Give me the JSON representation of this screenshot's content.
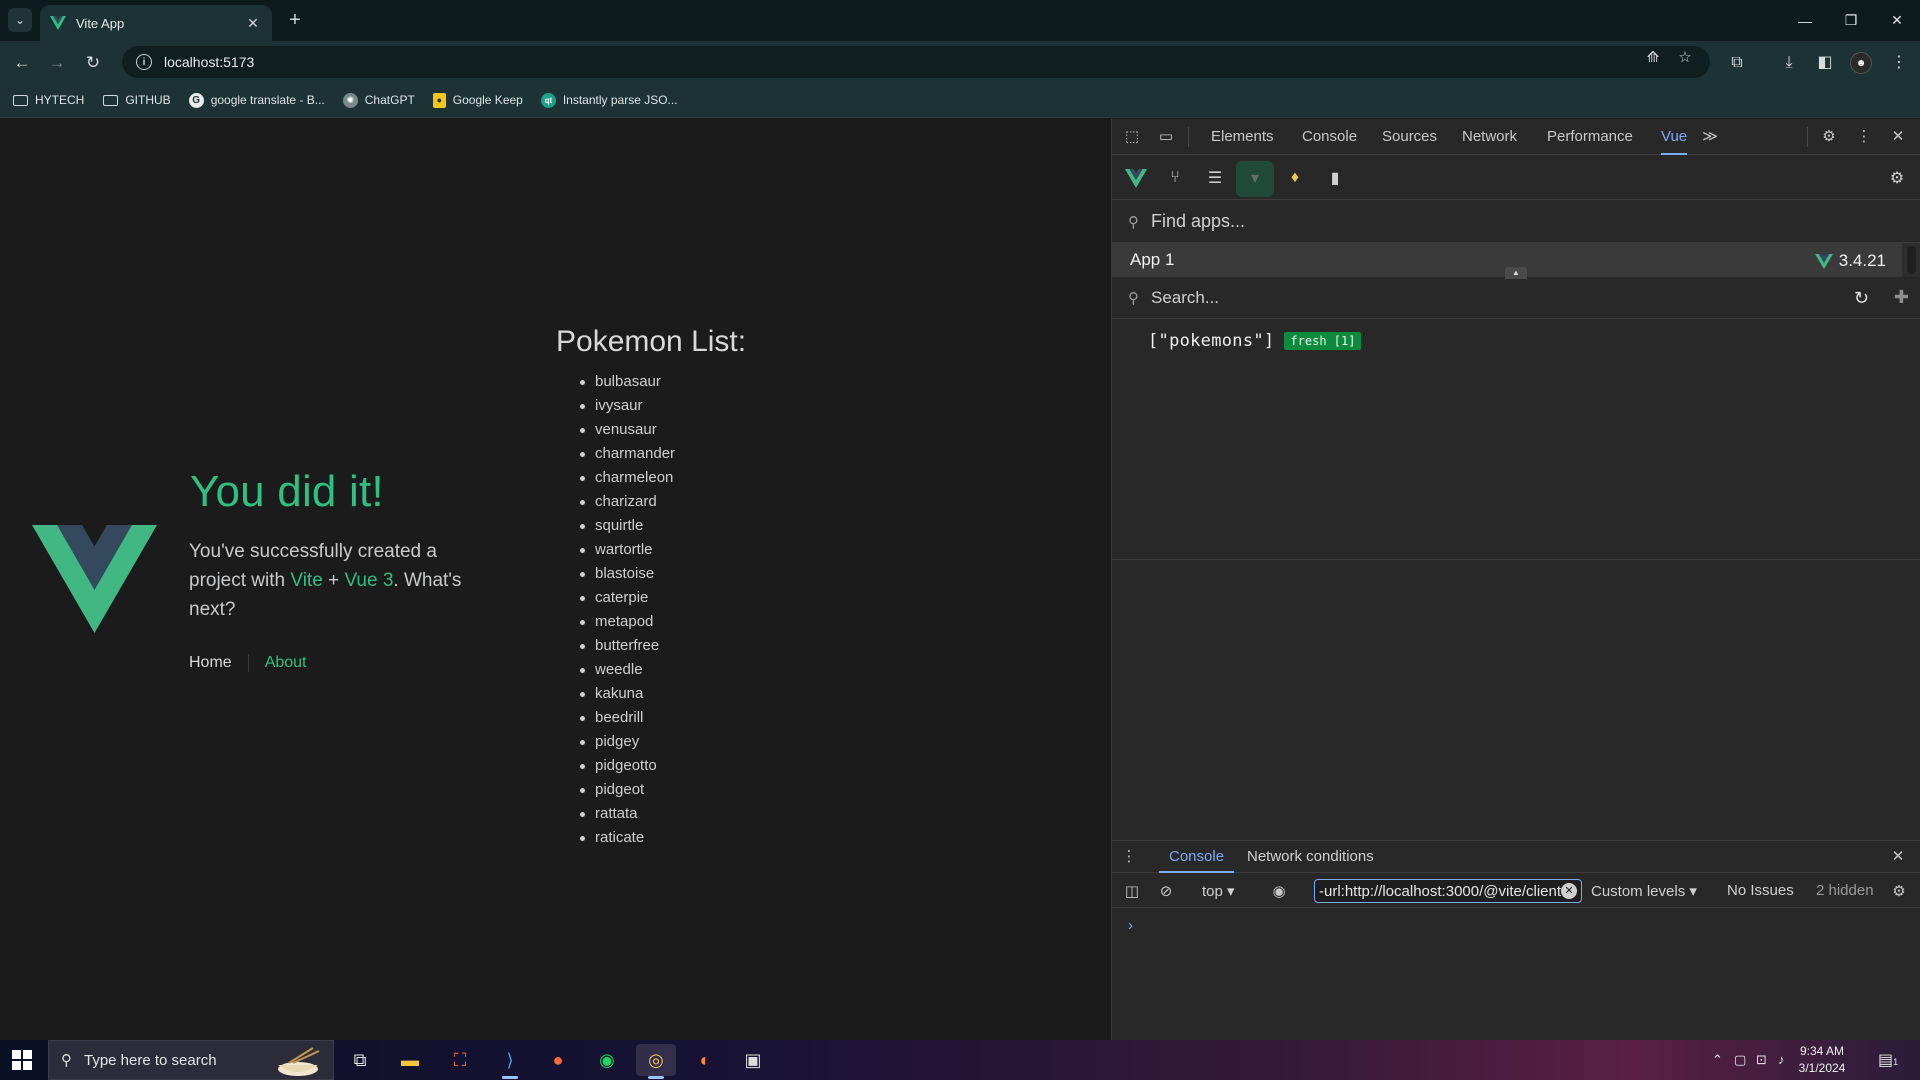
{
  "browser": {
    "tab_title": "Vite App",
    "tab_close": "✕",
    "new_tab": "+",
    "url": "localhost:5173",
    "window_controls": {
      "minimize": "—",
      "restore": "❐",
      "close": "✕"
    },
    "bookmarks": [
      {
        "label": "HYTECH",
        "icon": "folder-icon"
      },
      {
        "label": "GITHUB",
        "icon": "folder-icon"
      },
      {
        "label": "google translate - B...",
        "icon": "google-icon"
      },
      {
        "label": "ChatGPT",
        "icon": "chatgpt-icon"
      },
      {
        "label": "Google Keep",
        "icon": "keep-icon"
      },
      {
        "label": "Instantly parse JSO...",
        "icon": "quicktype-icon"
      }
    ]
  },
  "page": {
    "hero_title": "You did it!",
    "hero_line1": "You've successfully created a project with ",
    "hero_link_vite": "Vite",
    "hero_plus": " + ",
    "hero_link_vue": "Vue 3",
    "hero_end": ". What's next?",
    "nav_home": "Home",
    "nav_about": "About",
    "list_title": "Pokemon List:",
    "pokemons": [
      "bulbasaur",
      "ivysaur",
      "venusaur",
      "charmander",
      "charmeleon",
      "charizard",
      "squirtle",
      "wartortle",
      "blastoise",
      "caterpie",
      "metapod",
      "butterfree",
      "weedle",
      "kakuna",
      "beedrill",
      "pidgey",
      "pidgeotto",
      "pidgeot",
      "rattata",
      "raticate"
    ]
  },
  "devtools": {
    "tabs": [
      "Elements",
      "Console",
      "Sources",
      "Network",
      "Performance",
      "Vue"
    ],
    "active_tab": "Vue",
    "more_tabs": "≫",
    "find_apps_placeholder": "Find apps...",
    "app_name": "App 1",
    "vue_version": "3.4.21",
    "search_placeholder": "Search...",
    "query_key": "[\"pokemons\"]",
    "query_status": "fresh [1]",
    "drawer_tabs": [
      "Console",
      "Network conditions"
    ],
    "console_context": "top",
    "console_filter": "-url:http://localhost:3000/@vite/client",
    "log_levels": "Custom levels",
    "issues": "No Issues",
    "hidden_count": "2 hidden",
    "prompt": "›"
  },
  "taskbar": {
    "search_placeholder": "Type here to search",
    "time": "9:34 AM",
    "date": "3/1/2024",
    "notification_count": "1"
  },
  "colors": {
    "vue_green": "#2fbf83",
    "vue_dark": "#35495e",
    "devtools_accent": "#7cacf8",
    "fresh_badge": "#0e8a3e"
  }
}
